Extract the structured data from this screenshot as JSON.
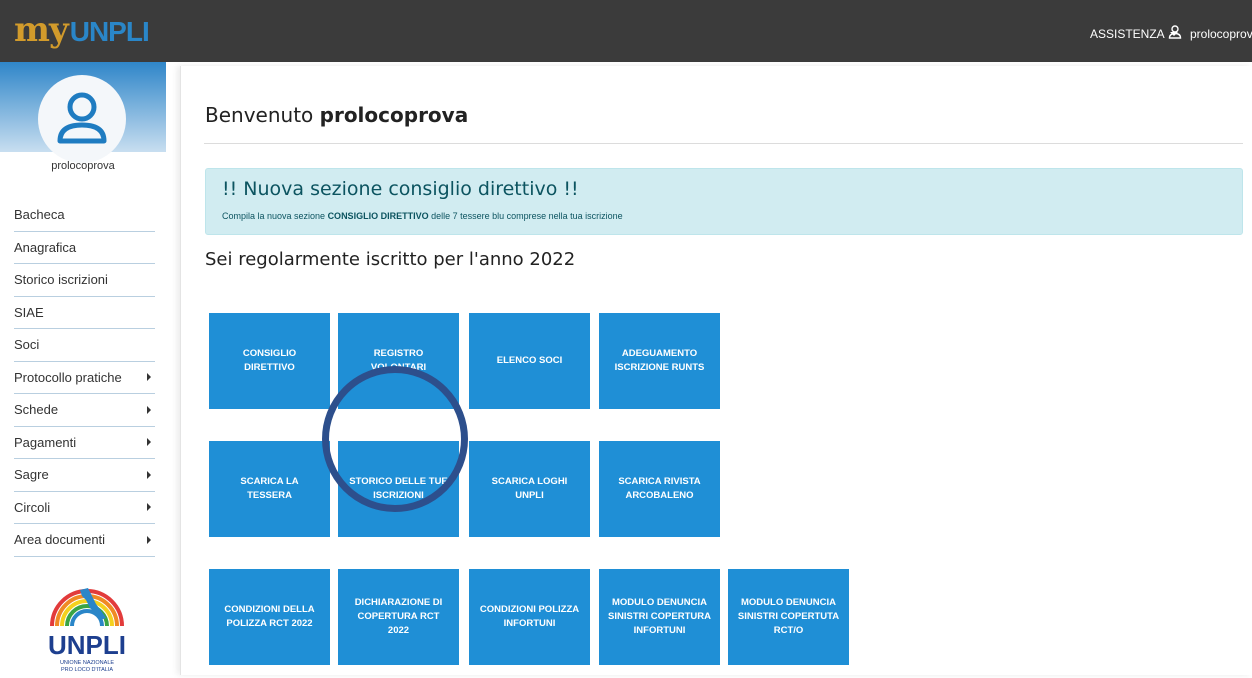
{
  "header": {
    "logo_my": "my",
    "logo_unpli": "UNPLI",
    "assist_label": "ASSISTENZA",
    "username": "prolocoprova"
  },
  "sidebar": {
    "username": "prolocoprova",
    "items": [
      {
        "label": "Bacheca",
        "submenu": false
      },
      {
        "label": "Anagrafica",
        "submenu": false
      },
      {
        "label": "Storico iscrizioni",
        "submenu": false
      },
      {
        "label": "SIAE",
        "submenu": false
      },
      {
        "label": "Soci",
        "submenu": false
      },
      {
        "label": "Protocollo pratiche",
        "submenu": true
      },
      {
        "label": "Schede",
        "submenu": true
      },
      {
        "label": "Pagamenti",
        "submenu": true
      },
      {
        "label": "Sagre",
        "submenu": true
      },
      {
        "label": "Circoli",
        "submenu": true
      },
      {
        "label": "Area documenti",
        "submenu": true
      }
    ],
    "logo_text": "UNPLI",
    "logo_subtext_1": "UNIONE NAZIONALE",
    "logo_subtext_2": "PRO LOCO D'ITALIA"
  },
  "main": {
    "welcome_prefix": "Benvenuto ",
    "welcome_user": "prolocoprova",
    "alert": {
      "title": "!! Nuova sezione consiglio direttivo !!",
      "text_before": "Compila la nuova sezione ",
      "text_bold": "CONSIGLIO DIRETTIVO",
      "text_after": " delle 7 tessere blu comprese nella tua iscrizione"
    },
    "subtitle": "Sei regolarmente iscritto per l'anno 2022",
    "tiles": [
      "CONSIGLIO DIRETTIVO",
      "REGISTRO VOLONTARI",
      "ELENCO SOCI",
      "ADEGUAMENTO ISCRIZIONE RUNTS",
      "SCARICA LA TESSERA",
      "STORICO DELLE TUE ISCRIZIONI",
      "SCARICA LOGHI UNPLI",
      "SCARICA RIVISTA ARCOBALENO",
      "CONDIZIONI DELLA POLIZZA RCT 2022",
      "DICHIARAZIONE DI COPERTURA RCT 2022",
      "CONDIZIONI POLIZZA INFORTUNI",
      "MODULO DENUNCIA SINISTRI COPERTURA INFORTUNI",
      "MODULO DENUNCIA SINISTRI COPERTUTA RCT/O"
    ]
  },
  "colors": {
    "topbar": "#3b3b3b",
    "tile": "#1f8fd6",
    "alert_bg": "#d1ecf1",
    "annotation_circle": "#2d4f8c"
  }
}
